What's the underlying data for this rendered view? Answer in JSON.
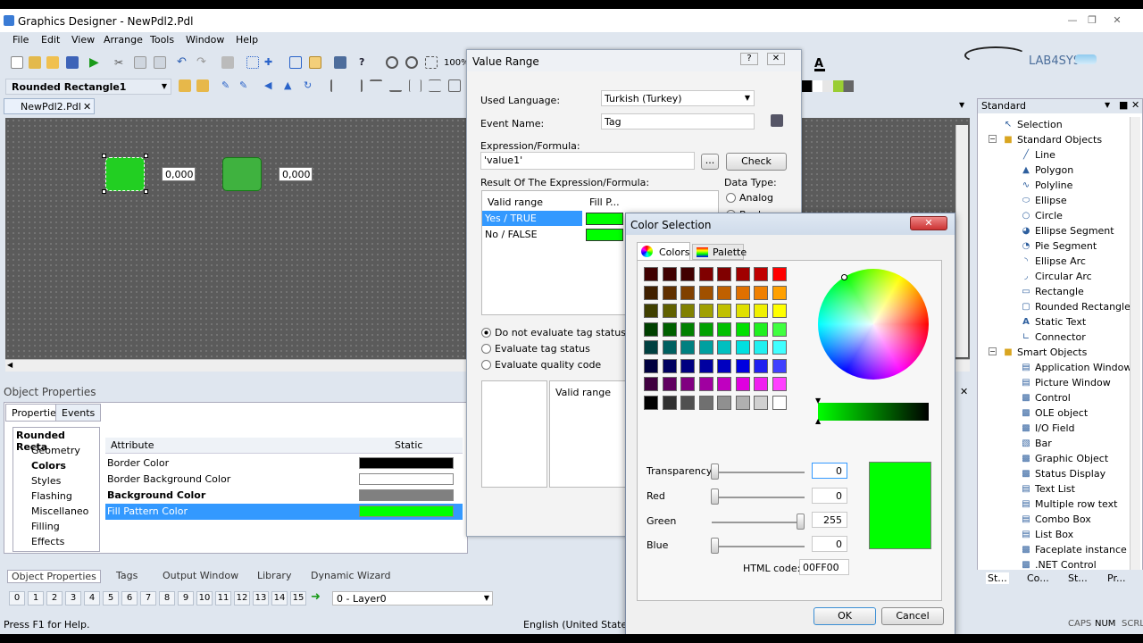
{
  "app": {
    "title": "Graphics Designer - NewPdl2.Pdl",
    "menu": [
      "File",
      "Edit",
      "View",
      "Arrange",
      "Tools",
      "Window",
      "Help"
    ],
    "zoom": "100%",
    "object_selector": "Rounded Rectangle1",
    "doc_tab": "NewPdl2.Pdl",
    "logo_text": "LAB4SYS"
  },
  "canvas": {
    "io_values": [
      "0,000",
      "0,000"
    ]
  },
  "object_properties": {
    "title": "Object Properties",
    "tabs": [
      "Properties",
      "Events"
    ],
    "tree_root": "Rounded Recta",
    "tree_items": [
      "Geometry",
      "Colors",
      "Styles",
      "Flashing",
      "Miscellaneo",
      "Filling",
      "Effects"
    ],
    "col_attribute": "Attribute",
    "col_static": "Static",
    "rows": [
      {
        "name": "Border Color",
        "color": "#000000"
      },
      {
        "name": "Border Background Color",
        "color": "#ffffff"
      },
      {
        "name": "Background Color",
        "color": "#808080"
      },
      {
        "name": "Fill Pattern Color",
        "color": "#00ff00"
      }
    ]
  },
  "bottom_tabs": [
    "Object Properties",
    "Tags",
    "Output Window",
    "Library",
    "Dynamic Wizard"
  ],
  "layers": {
    "buttons": [
      "0",
      "1",
      "2",
      "3",
      "4",
      "5",
      "6",
      "7",
      "8",
      "9",
      "10",
      "11",
      "12",
      "13",
      "14",
      "15"
    ],
    "current": "0 - Layer0"
  },
  "status": {
    "help": "Press F1 for Help.",
    "language": "English (United States)",
    "indicators": [
      "CAPS",
      "NUM",
      "SCRL"
    ]
  },
  "standard_panel": {
    "title": "Standard",
    "selection": "Selection",
    "group1": "Standard Objects",
    "items1": [
      "Line",
      "Polygon",
      "Polyline",
      "Ellipse",
      "Circle",
      "Ellipse Segment",
      "Pie Segment",
      "Ellipse Arc",
      "Circular Arc",
      "Rectangle",
      "Rounded Rectangle",
      "Static Text",
      "Connector"
    ],
    "group2": "Smart Objects",
    "items2": [
      "Application Window",
      "Picture Window",
      "Control",
      "OLE object",
      "I/O Field",
      "Bar",
      "Graphic Object",
      "Status Display",
      "Text List",
      "Multiple row text",
      "Combo Box",
      "List Box",
      "Faceplate instance",
      ".NET Control"
    ],
    "bottom_tabs": [
      "St...",
      "Co...",
      "St...",
      "Pr..."
    ]
  },
  "value_range": {
    "title": "Value Range",
    "used_language_label": "Used Language:",
    "used_language": "Turkish (Turkey)",
    "event_name_label": "Event Name:",
    "event_name": "Tag",
    "expr_label": "Expression/Formula:",
    "expr_value": "'value1'",
    "browse": "...",
    "check": "Check",
    "result_label": "Result Of The Expression/Formula:",
    "col_valid": "Valid range",
    "col_fill": "Fill P...",
    "rows": [
      "Yes / TRUE",
      "No / FALSE"
    ],
    "data_type_label": "Data Type:",
    "analog": "Analog",
    "boolean": "Boolean",
    "opt1": "Do not evaluate tag status",
    "opt2": "Evaluate tag status",
    "opt3": "Evaluate quality code",
    "lower_col": "Valid range"
  },
  "color_selection": {
    "title": "Color Selection",
    "tab_colors": "Colors",
    "tab_palette": "Palette",
    "transparency_label": "Transparency",
    "transparency": "0",
    "red_label": "Red",
    "red": "0",
    "green_label": "Green",
    "green": "255",
    "blue_label": "Blue",
    "blue": "0",
    "html_label": "HTML code:",
    "html_code": "00FF00",
    "ok": "OK",
    "cancel": "Cancel",
    "preview_color": "#00ff00",
    "grid_colors": [
      [
        "#400000",
        "#400000",
        "#400000",
        "#800000",
        "#800000",
        "#a00000",
        "#c00000",
        "#ff0000"
      ],
      [
        "#402000",
        "#603000",
        "#804000",
        "#a05000",
        "#c06000",
        "#e07000",
        "#f08000",
        "#ffa000"
      ],
      [
        "#404000",
        "#606000",
        "#808000",
        "#a0a000",
        "#c0c000",
        "#e0e000",
        "#f0f000",
        "#ffff00"
      ],
      [
        "#004000",
        "#006000",
        "#008000",
        "#00a000",
        "#00c000",
        "#00e000",
        "#20f020",
        "#40ff40"
      ],
      [
        "#004040",
        "#006060",
        "#008080",
        "#00a0a0",
        "#00c0c0",
        "#00e0e0",
        "#20f0f0",
        "#40ffff"
      ],
      [
        "#000040",
        "#000060",
        "#000080",
        "#0000a0",
        "#0000c0",
        "#0000e0",
        "#2020f0",
        "#4040ff"
      ],
      [
        "#400040",
        "#600060",
        "#800080",
        "#a000a0",
        "#c000c0",
        "#e000e0",
        "#f020f0",
        "#ff40ff"
      ],
      [
        "#000000",
        "#303030",
        "#505050",
        "#707070",
        "#909090",
        "#b0b0b0",
        "#d0d0d0",
        "#ffffff"
      ]
    ]
  }
}
